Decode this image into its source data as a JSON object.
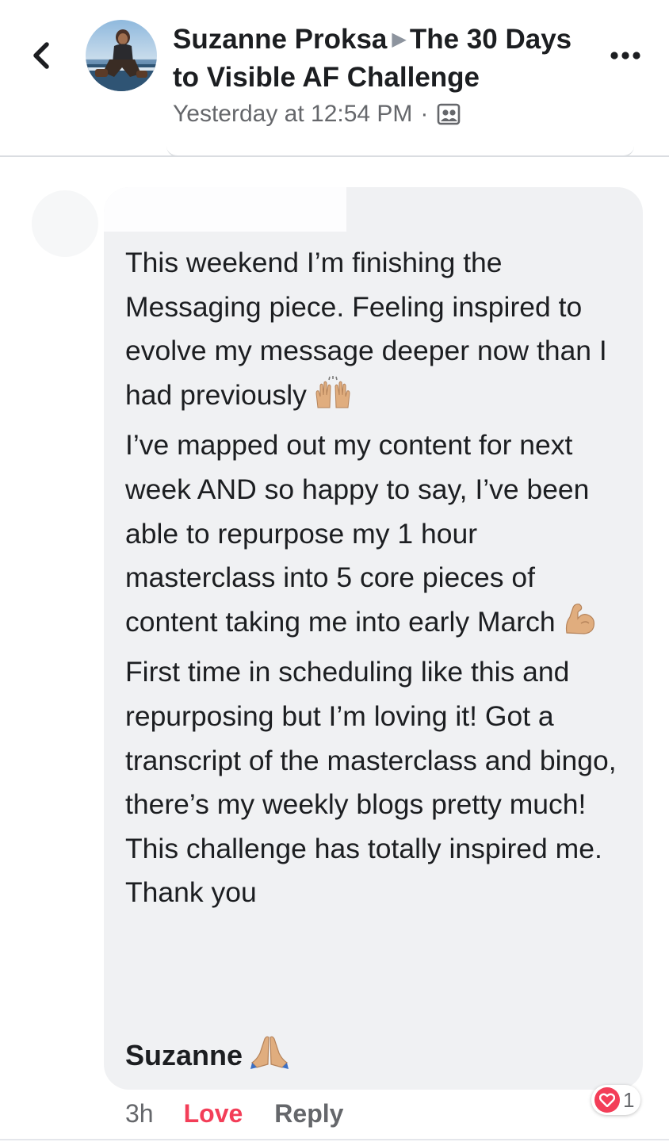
{
  "header": {
    "back_icon": "chevron-left-icon",
    "author": "Suzanne Proksa",
    "group": "The 30 Days to Visible AF Challenge",
    "timestamp": "Yesterday at 12:54 PM",
    "separator": "·",
    "audience_icon": "group-privacy-icon",
    "more_icon": "more-dots-icon"
  },
  "comment": {
    "paragraphs": [
      {
        "text": "This weekend I’m finishing the Messaging piece. Feeling inspired to evolve my message deeper now than I had previously",
        "emoji": "raising-hands-icon"
      },
      {
        "text": "I’ve mapped out my content for next week AND so happy to say, I’ve been able to repurpose my 1 hour masterclass into 5 core pieces of content taking me into early March",
        "emoji": "flexed-biceps-icon"
      },
      {
        "text": "First time in scheduling like this and repurposing but I’m loving it! Got a transcript of the masterclass and bingo, there’s my weekly blogs pretty much! This challenge has totally inspired me. Thank you",
        "emoji": ""
      }
    ],
    "tag_name": "Suzanne",
    "tag_emoji": "folded-hands-icon"
  },
  "actions": {
    "time": "3h",
    "love": "Love",
    "reply": "Reply"
  },
  "reactions": {
    "icon": "heart-icon",
    "count": "1"
  },
  "colors": {
    "love": "#f33e58",
    "secondary_text": "#65676b",
    "bubble": "#f0f1f3"
  }
}
